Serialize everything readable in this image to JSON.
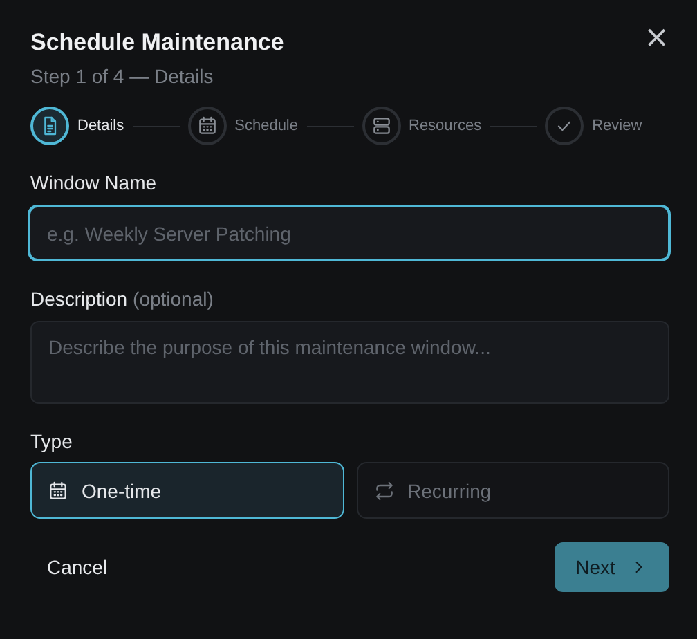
{
  "dialog": {
    "title": "Schedule Maintenance",
    "subtitle": "Step 1 of 4 — Details",
    "close": "×"
  },
  "steps": [
    {
      "label": "Details",
      "kind": "document",
      "selected": true
    },
    {
      "label": "Schedule",
      "kind": "calendar",
      "selected": false
    },
    {
      "label": "Resources",
      "kind": "server",
      "selected": false
    },
    {
      "label": "Review",
      "kind": "check",
      "selected": false
    }
  ],
  "window_name": {
    "label": "Window Name",
    "placeholder": "e.g. Weekly Server Patching",
    "focused": true
  },
  "description": {
    "label": "Description",
    "hint": "(optional)",
    "placeholder": "Describe the purpose of this maintenance window..."
  },
  "type": {
    "label": "Type",
    "options": [
      {
        "label": "One-time",
        "kind": "calendar",
        "selected": true
      },
      {
        "label": "Recurring",
        "kind": "repeat",
        "selected": false
      }
    ]
  },
  "footer": {
    "cancel": "Cancel",
    "next": "Next"
  }
}
